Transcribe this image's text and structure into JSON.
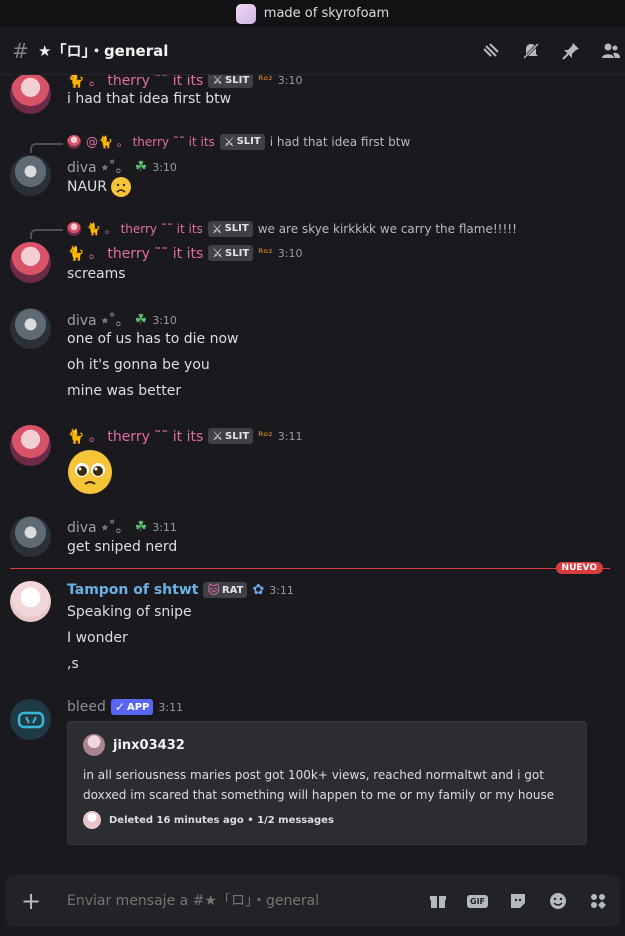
{
  "window": {
    "server_name": "made of skyrofoam"
  },
  "channel": {
    "name": "★「ロ」・general"
  },
  "messages": [
    {
      "author": "🐈 。 therry ˜˜ it its",
      "tag": "SLIT",
      "suffix": "ᴿᵒᶻ",
      "time": "3:10",
      "lines": [
        "i had that idea first btw"
      ]
    },
    {
      "reply": {
        "mention": "@🐈 。 therry ˜˜ it its",
        "tag": "SLIT",
        "text": "i had that idea first btw"
      },
      "author": "diva ⭒˚。",
      "time": "3:10",
      "lines": [
        "NAUR"
      ]
    },
    {
      "reply": {
        "mention": "🐈 。 therry ˜˜ it its",
        "tag": "SLIT",
        "text": "we are skye kirkkkk we carry the flame!!!!!"
      },
      "author": "🐈 。 therry ˜˜ it its",
      "tag": "SLIT",
      "suffix": "ᴿᵒᶻ",
      "time": "3:10",
      "lines": [
        "screams"
      ]
    },
    {
      "author": "diva ⭒˚。",
      "time": "3:10",
      "lines": [
        "one of us has to die now",
        "oh it's gonna be you",
        "mine was better"
      ]
    },
    {
      "author": "🐈 。 therry ˜˜ it its",
      "tag": "SLIT",
      "suffix": "ᴿᵒᶻ",
      "time": "3:11",
      "lines": []
    },
    {
      "author": "diva ⭒˚。",
      "time": "3:11",
      "lines": [
        "get sniped nerd"
      ]
    },
    {
      "author": "Tampon of shtwt",
      "tag": "RAT",
      "time": "3:11",
      "lines": [
        "Speaking of snipe",
        "I wonder",
        ",s"
      ]
    },
    {
      "author": "bleed",
      "tag": "APP",
      "time": "3:11"
    }
  ],
  "new_divider": {
    "label": "NUEVO"
  },
  "embed": {
    "author": "jinx03432",
    "description": "in all seriousness maries post got 100k+ views, reached normaltwt and i got doxxed im scared that something will happen to me or my family or my house",
    "footer": "Deleted 16 minutes ago • 1/2 messages"
  },
  "composer": {
    "placeholder": "Enviar mensaje a #★「ロ」・general"
  },
  "icons": [
    "threads-icon",
    "mute-icon",
    "pin-icon",
    "members-icon",
    "gift-icon",
    "gif-icon",
    "sticker-icon",
    "emoji-icon",
    "apps-icon"
  ]
}
